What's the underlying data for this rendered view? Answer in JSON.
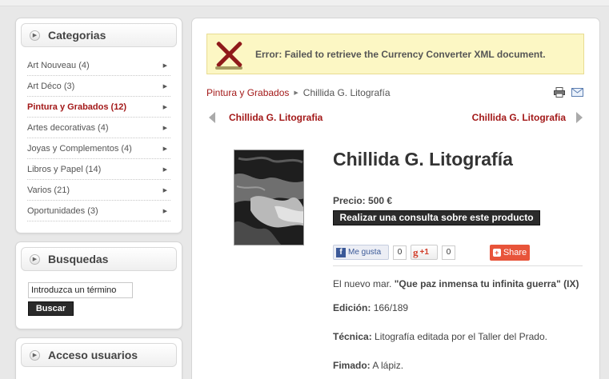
{
  "sidebar": {
    "categories": {
      "title": "Categorias",
      "items": [
        {
          "label": "Art Nouveau (4)"
        },
        {
          "label": "Art Déco (3)"
        },
        {
          "label": "Pintura y Grabados (12)"
        },
        {
          "label": "Artes decorativas (4)"
        },
        {
          "label": "Joyas y Complementos (4)"
        },
        {
          "label": "Libros y Papel (14)"
        },
        {
          "label": "Varios (21)"
        },
        {
          "label": "Oportunidades (3)"
        }
      ]
    },
    "search": {
      "title": "Busquedas",
      "input_value": "Introduzca un término",
      "button_label": "Buscar"
    },
    "access": {
      "title": "Acceso usuarios"
    }
  },
  "error": {
    "message": "Error: Failed to retrieve the Currency Converter XML document."
  },
  "breadcrumb": {
    "category": "Pintura y Grabados",
    "current": "Chillida G. Litografía"
  },
  "nav": {
    "prev_label": "Chillida G. Litografia",
    "next_label": "Chillida G. Litografia"
  },
  "product": {
    "title": "Chillida G. Litografía",
    "price": "Precio: 500 €",
    "consult_label": "Realizar una consulta sobre este producto",
    "social": {
      "facebook_label": "Me gusta",
      "facebook_count": "0",
      "gplus_label": "+1",
      "gplus_count": "0",
      "share_label": "Share"
    },
    "description": {
      "intro": "El nuevo mar.",
      "quote": "\"Que paz inmensa tu infinita guerra\" (IX)",
      "edition_label": "Edición:",
      "edition_value": "166/189",
      "technique_label": "Técnica:",
      "technique_value": "Litografía editada por el Taller del Prado.",
      "signed_label": "Fimado:",
      "signed_value": "A lápiz."
    }
  },
  "colors": {
    "accent": "#a31919",
    "error_bg": "#fcf7c4",
    "dark_button": "#2b2b2b"
  }
}
